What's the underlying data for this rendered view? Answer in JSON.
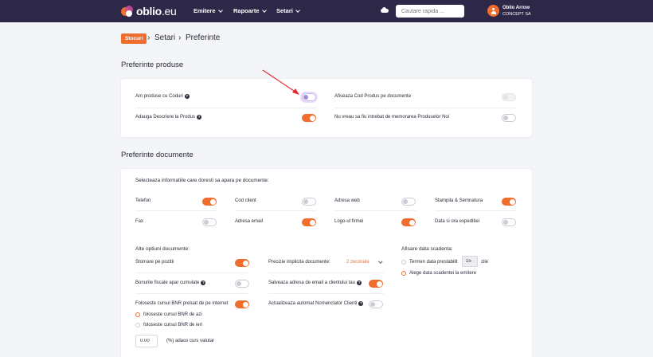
{
  "nav": {
    "brand": "oblio",
    "brand_suffix": ".eu",
    "items": [
      "Emitere",
      "Rapoarte",
      "Setari"
    ],
    "search_placeholder": "Cautare rapida ...",
    "user_name": "Oblio Arrow",
    "user_company": "CONCEPT SA"
  },
  "breadcrumb": {
    "badge": "Stocuri",
    "items": [
      "Setari",
      "Preferinte"
    ]
  },
  "products": {
    "title": "Preferinte produse",
    "options": [
      {
        "label": "Am produse cu Coduri",
        "help": true,
        "state": "focus"
      },
      {
        "label": "Afiseaza Cod Produs pe documente",
        "help": false,
        "state": "disabled"
      },
      {
        "label": "Adauga Descriere la Produs",
        "help": true,
        "state": "on"
      },
      {
        "label": "Nu vreau sa fiu intrebat de memorarea Produselor Noi",
        "help": false,
        "state": "off"
      }
    ]
  },
  "documents": {
    "title": "Preferinte documente",
    "subtitle": "Selecteaza informatiile care doresti sa apara pe documente:",
    "info_fields": [
      {
        "label": "Telefon",
        "state": "on"
      },
      {
        "label": "Cod client",
        "state": "off"
      },
      {
        "label": "Adresa web",
        "state": "off"
      },
      {
        "label": "Stampila & Semnatura",
        "state": "on"
      },
      {
        "label": "Fax",
        "state": "off"
      },
      {
        "label": "Adresa email",
        "state": "on"
      },
      {
        "label": "Logo-ul firmei",
        "state": "on"
      },
      {
        "label": "Data si ora expeditiei",
        "state": "off"
      }
    ],
    "other_title": "Alte optiuni documente:",
    "col1": [
      {
        "label": "Stornare pe pozitii",
        "help": false,
        "state": "on"
      },
      {
        "label": "Bonurile fiscale apar cumulate",
        "help": true,
        "state": "off"
      },
      {
        "label": "Foloseste cursul BNR preluat de pe internet",
        "help": false,
        "state": "on"
      }
    ],
    "bnr_radios": [
      {
        "label": "foloseste cursul BNR de azi",
        "selected": true
      },
      {
        "label": "foloseste cursul BNR de ieri",
        "selected": false
      }
    ],
    "surcharge": {
      "value": "0.00",
      "label": "(%) adaos curs valutar"
    },
    "col2": {
      "precision_label": "Precizie implicita documente:",
      "precision_value": "2 zecimale",
      "email_label": "Salveaza adresa de email a clientului tau",
      "email_help": true,
      "email_state": "on",
      "nomenclator_label": "Actualizeaza automat Nomenclator Clienti",
      "nomenclator_help": true,
      "nomenclator_state": "off"
    },
    "due_date": {
      "title": "Afisare data scadenta:",
      "term_label": "Termen data prestabilit",
      "term_value": "15",
      "term_unit": "zile",
      "choose_label": "Alege data scadentei la emitere",
      "selected": "choose"
    }
  },
  "colors": {
    "accent": "#ef6d2d",
    "nav_bg": "#2d2847",
    "annotation_arrow": "#e32b2b"
  }
}
